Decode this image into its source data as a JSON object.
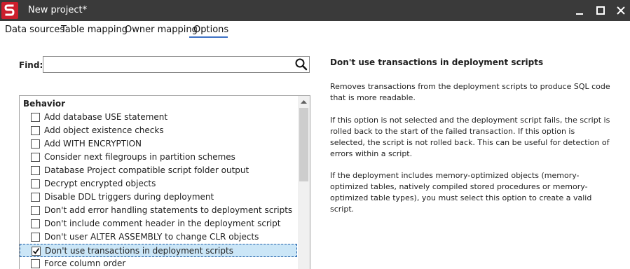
{
  "window": {
    "title": "New project*",
    "logo_letter": "S",
    "accent_color": "#cc1f2d"
  },
  "tabs": [
    {
      "label": "Data sources"
    },
    {
      "label": "Table mapping"
    },
    {
      "label": "Owner mapping"
    },
    {
      "label": "Options",
      "active": true
    }
  ],
  "find": {
    "label": "Find:",
    "value": "",
    "placeholder": ""
  },
  "options": {
    "group": "Behavior",
    "items": [
      {
        "label": "Add database USE statement",
        "checked": false
      },
      {
        "label": "Add object existence checks",
        "checked": false
      },
      {
        "label": "Add WITH ENCRYPTION",
        "checked": false
      },
      {
        "label": "Consider next filegroups in partition schemes",
        "checked": false
      },
      {
        "label": "Database Project compatible script folder output",
        "checked": false
      },
      {
        "label": "Decrypt encrypted objects",
        "checked": false
      },
      {
        "label": "Disable DDL triggers during deployment",
        "checked": false
      },
      {
        "label": "Don't add error handling statements to deployment scripts",
        "checked": false
      },
      {
        "label": "Don't include comment header in the deployment script",
        "checked": false
      },
      {
        "label": "Don't user ALTER ASSEMBLY to change CLR objects",
        "checked": false
      },
      {
        "label": "Don't use transactions in deployment scripts",
        "checked": true,
        "selected": true
      },
      {
        "label": "Force column order",
        "checked": false
      }
    ]
  },
  "description": {
    "title": "Don't use transactions in deployment scripts",
    "paragraphs": [
      "Removes transactions from the deployment scripts to produce SQL code that is more readable.",
      "If this option is not selected and the deployment script fails, the script is rolled back to the start of the failed transaction. If this option is selected, the script is not rolled back. This can be useful for detection of errors within a script.",
      "If the deployment includes memory-optimized objects (memory-optimized tables, natively compiled stored procedures or memory-optimized table types), you must select this option to create a valid script."
    ]
  }
}
